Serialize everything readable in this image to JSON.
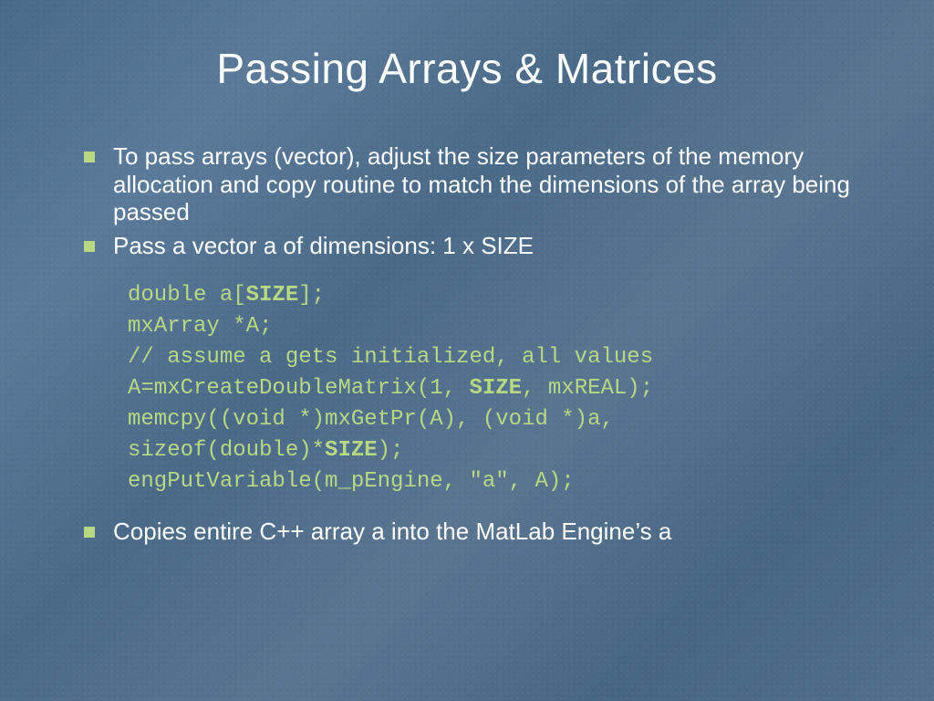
{
  "title": "Passing Arrays & Matrices",
  "bullets": {
    "b1": "To pass arrays (vector), adjust the size parameters of the memory allocation and copy routine to match the dimensions of the array being passed",
    "b2": "Pass a vector a of dimensions: 1 x SIZE",
    "b3": "Copies entire C++ array a into the MatLab Engine’s a"
  },
  "code": {
    "l1a": "double a[",
    "l1b": "SIZE",
    "l1c": "];",
    "l2": "mxArray *A;",
    "l3": "// assume a gets initialized, all values",
    "l4a": "A=mxCreateDoubleMatrix(1, ",
    "l4b": "SIZE",
    "l4c": ", mxREAL);",
    "l5a": "memcpy((void *)mxGetPr(A), (void *)a, sizeof(double)*",
    "l5b": "SIZE",
    "l5c": ");",
    "l6": "engPutVariable(m_pEngine, \"a\", A);"
  }
}
